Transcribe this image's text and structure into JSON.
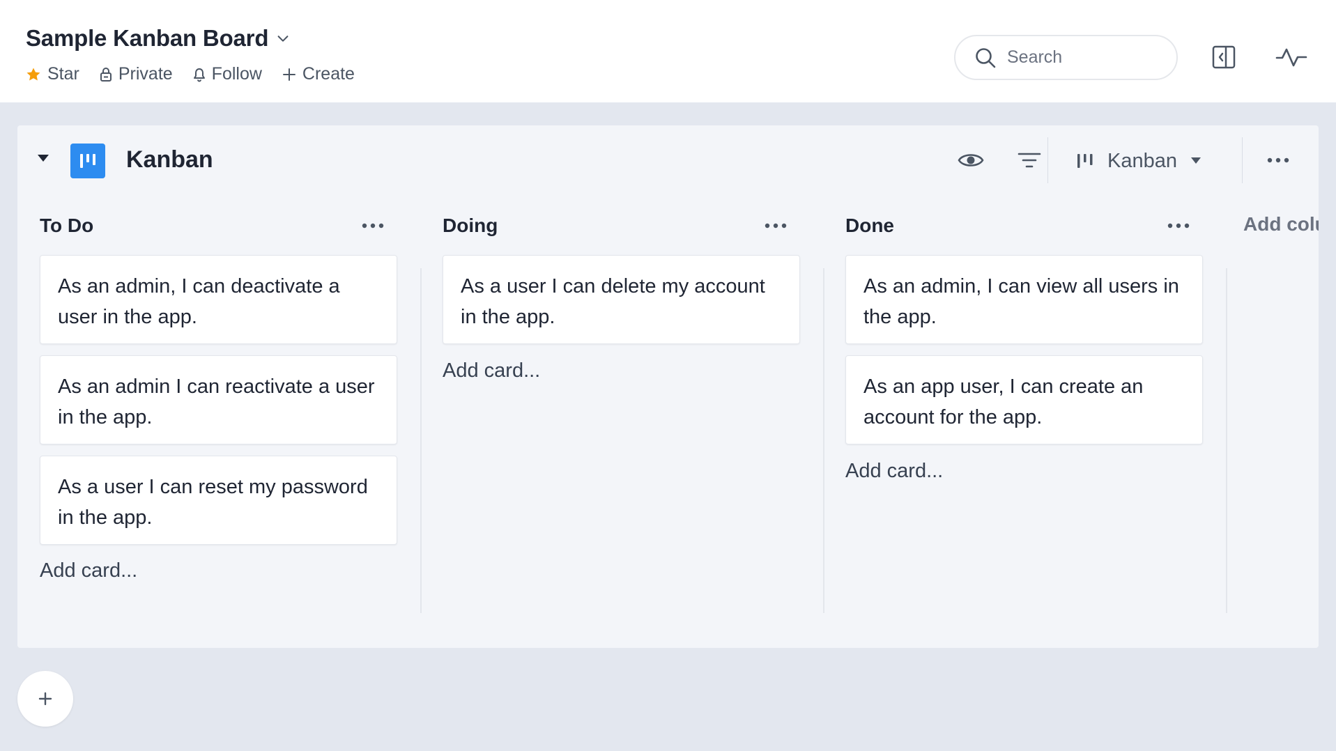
{
  "header": {
    "board_title": "Sample Kanban Board",
    "meta": {
      "star": "Star",
      "private": "Private",
      "follow": "Follow",
      "create": "Create"
    },
    "search_placeholder": "Search"
  },
  "panel": {
    "title": "Kanban",
    "view_label": "Kanban",
    "add_column": "Add column"
  },
  "columns": [
    {
      "title": "To Do",
      "cards": [
        "As an admin, I can deactivate a user in the app.",
        "As an admin I can reactivate a user in the app.",
        "As a user I can reset my password in the app."
      ],
      "add_card": "Add card..."
    },
    {
      "title": "Doing",
      "cards": [
        "As a user I can delete my account in the app."
      ],
      "add_card": "Add card..."
    },
    {
      "title": "Done",
      "cards": [
        "As an admin, I can view all users in the app.",
        "As an app user, I can create an account for the app."
      ],
      "add_card": "Add card..."
    }
  ],
  "colors": {
    "accent": "#2d8cf0",
    "star": "#f59e0b",
    "background": "#e3e7ef",
    "panel": "#f3f5f9"
  }
}
